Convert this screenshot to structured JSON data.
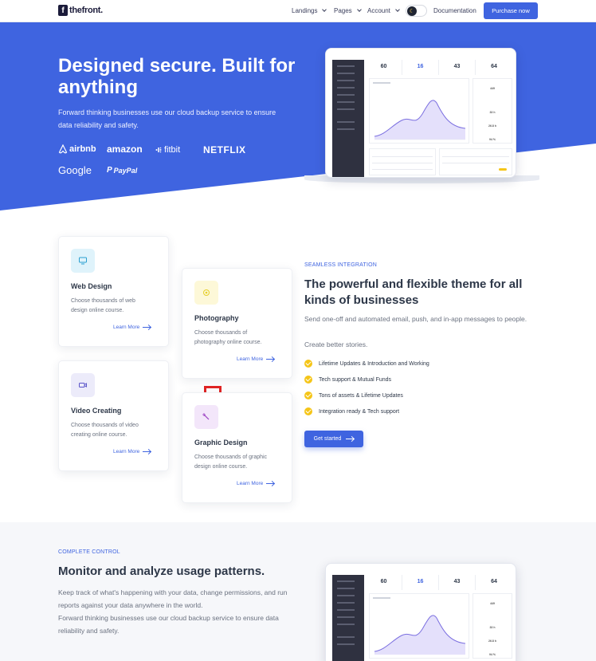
{
  "nav": {
    "logo_mark": "f",
    "logo_text": "thefront.",
    "items": [
      "Landings",
      "Pages",
      "Account"
    ],
    "documentation": "Documentation",
    "purchase": "Purchase now",
    "theme_toggle_icon": "moon-icon"
  },
  "hero": {
    "title": "Designed secure. Built for anything",
    "subtitle": "Forward thinking businesses use our cloud backup service to ensure data reliability and safety.",
    "brands": [
      "airbnb",
      "amazon",
      "fitbit",
      "NETFLIX",
      "Google",
      "PayPal"
    ]
  },
  "dashboard": {
    "stats": [
      {
        "label": "",
        "value": "60"
      },
      {
        "label": "",
        "value": "16"
      },
      {
        "label": "",
        "value": "43"
      },
      {
        "label": "",
        "value": "64"
      }
    ],
    "side_values": [
      "449",
      "33 h",
      "26.8 h",
      "94 %"
    ]
  },
  "cards": [
    {
      "title": "Web Design",
      "text": "Choose thousands of web design online course.",
      "link": "Learn More",
      "icon": "monitor-icon"
    },
    {
      "title": "Photography",
      "text": "Choose thousands of photography online course.",
      "link": "Learn More",
      "icon": "camera-icon"
    },
    {
      "title": "Video Creating",
      "text": "Choose thousands of video creating online course.",
      "link": "Learn More",
      "icon": "video-icon"
    },
    {
      "title": "Graphic Design",
      "text": "Choose thousands of graphic design online course.",
      "link": "Learn More",
      "icon": "magic-wand-icon"
    }
  ],
  "integration": {
    "eyebrow": "SEAMLESS INTEGRATION",
    "title": "The powerful and flexible theme for all kinds of businesses",
    "text1": "Send one-off and automated email, push, and in-app messages to people.",
    "text2": "Create better stories.",
    "checklist": [
      "Lifetime Updates & Introduction and Working",
      "Tech support & Mutual Funds",
      "Tons of assets & Lifetime Updates",
      "Integration ready & Tech support"
    ],
    "cta": "Get started"
  },
  "control": {
    "eyebrow": "COMPLETE CONTROL",
    "title": "Monitor and analyze usage patterns.",
    "text1": "Keep track of what's happening with your data, change permissions, and run reports against your data anywhere in the world.",
    "text2": "Forward thinking businesses use our cloud backup service to ensure data reliability and safety."
  },
  "colors": {
    "primary": "#3f64e0",
    "accent": "#f5c518",
    "dark": "#1b1b3a"
  }
}
